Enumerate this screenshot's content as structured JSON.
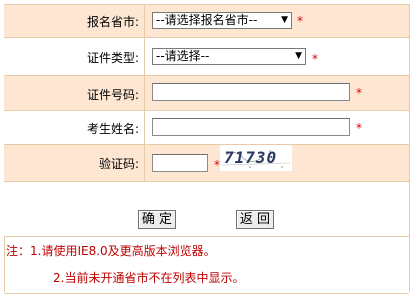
{
  "form": {
    "province": {
      "label": "报名省市:",
      "selected": "--请选择报名省市--",
      "required": "*"
    },
    "id_type": {
      "label": "证件类型:",
      "selected": "--请选择--",
      "required": "*"
    },
    "id_number": {
      "label": "证件号码:",
      "value": "",
      "required": "*"
    },
    "name": {
      "label": "考生姓名:",
      "value": "",
      "required": "*"
    },
    "captcha": {
      "label": "验证码:",
      "value": "",
      "required": "*",
      "image_text": "71730"
    }
  },
  "buttons": {
    "confirm": "确 定",
    "back": "返 回"
  },
  "notes": {
    "line1": "注：1.请使用IE8.0及更高版本浏览器。",
    "line2": "2.当前未开通省市不在列表中显示。"
  },
  "colors": {
    "row_peach": "#fde7d2",
    "required_red": "#e10000",
    "note_red": "#c00000",
    "border": "#e8c9a8"
  }
}
